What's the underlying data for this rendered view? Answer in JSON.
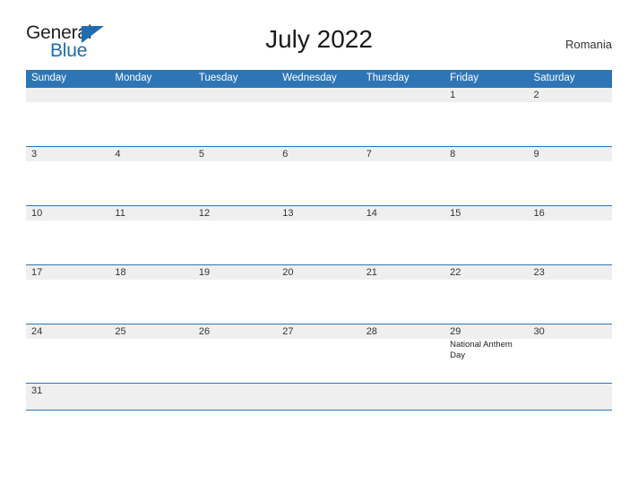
{
  "brand": {
    "name_part1": "General",
    "name_part2": "Blue",
    "triangle_icon": "triangle-icon",
    "accent_color": "#1f6cb0"
  },
  "header": {
    "title": "July 2022",
    "country": "Romania"
  },
  "colors": {
    "header_blue": "#2e75b6",
    "row_gray": "#efefef",
    "text_dark": "#333333"
  },
  "calendar": {
    "weekdays": [
      "Sunday",
      "Monday",
      "Tuesday",
      "Wednesday",
      "Thursday",
      "Friday",
      "Saturday"
    ],
    "weeks": [
      [
        {
          "date": "",
          "events": []
        },
        {
          "date": "",
          "events": []
        },
        {
          "date": "",
          "events": []
        },
        {
          "date": "",
          "events": []
        },
        {
          "date": "",
          "events": []
        },
        {
          "date": "1",
          "events": []
        },
        {
          "date": "2",
          "events": []
        }
      ],
      [
        {
          "date": "3",
          "events": []
        },
        {
          "date": "4",
          "events": []
        },
        {
          "date": "5",
          "events": []
        },
        {
          "date": "6",
          "events": []
        },
        {
          "date": "7",
          "events": []
        },
        {
          "date": "8",
          "events": []
        },
        {
          "date": "9",
          "events": []
        }
      ],
      [
        {
          "date": "10",
          "events": []
        },
        {
          "date": "11",
          "events": []
        },
        {
          "date": "12",
          "events": []
        },
        {
          "date": "13",
          "events": []
        },
        {
          "date": "14",
          "events": []
        },
        {
          "date": "15",
          "events": []
        },
        {
          "date": "16",
          "events": []
        }
      ],
      [
        {
          "date": "17",
          "events": []
        },
        {
          "date": "18",
          "events": []
        },
        {
          "date": "19",
          "events": []
        },
        {
          "date": "20",
          "events": []
        },
        {
          "date": "21",
          "events": []
        },
        {
          "date": "22",
          "events": []
        },
        {
          "date": "23",
          "events": []
        }
      ],
      [
        {
          "date": "24",
          "events": []
        },
        {
          "date": "25",
          "events": []
        },
        {
          "date": "26",
          "events": []
        },
        {
          "date": "27",
          "events": []
        },
        {
          "date": "28",
          "events": []
        },
        {
          "date": "29",
          "events": [
            "National Anthem Day"
          ]
        },
        {
          "date": "30",
          "events": []
        }
      ],
      [
        {
          "date": "31",
          "events": []
        },
        {
          "date": "",
          "events": []
        },
        {
          "date": "",
          "events": []
        },
        {
          "date": "",
          "events": []
        },
        {
          "date": "",
          "events": []
        },
        {
          "date": "",
          "events": []
        },
        {
          "date": "",
          "events": []
        }
      ]
    ]
  }
}
